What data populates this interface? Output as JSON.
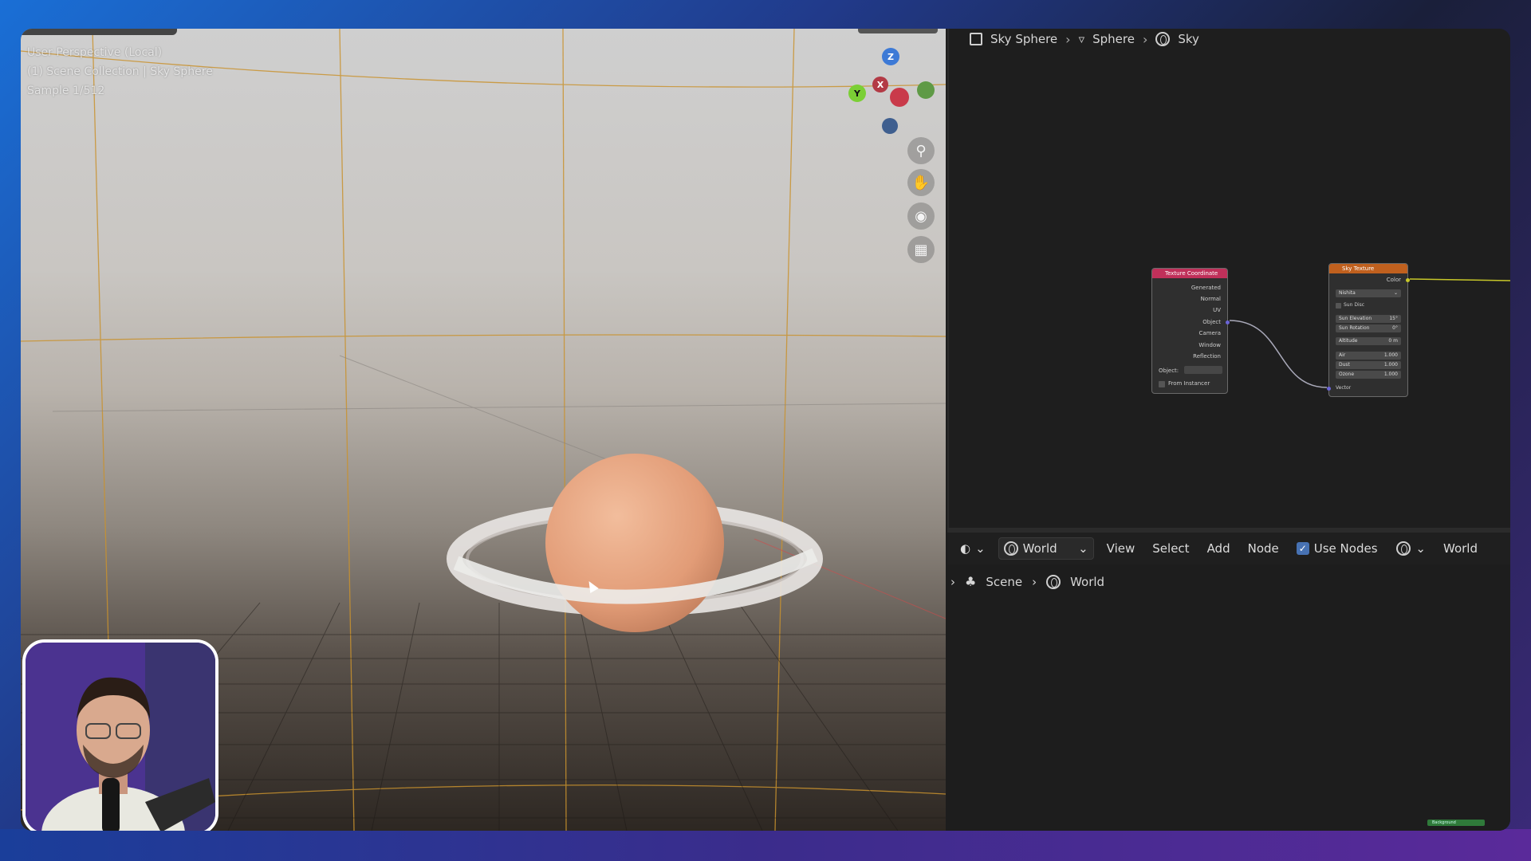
{
  "viewport": {
    "info_lines": [
      "User Perspective (Local)",
      "(1) Scene Collection | Sky Sphere",
      "Sample 1/512"
    ],
    "gizmo_axes": {
      "z": "Z",
      "y": "Y",
      "x": "X"
    },
    "nav_icons": [
      "zoom-icon",
      "pan-hand-icon",
      "camera-icon",
      "grid-icon"
    ]
  },
  "node_editor": {
    "breadcrumb": [
      "Sky Sphere",
      "Sphere",
      "Sky"
    ],
    "texture_coordinate_node": {
      "title": "Texture Coordinate",
      "outputs": [
        "Generated",
        "Normal",
        "UV",
        "Object",
        "Camera",
        "Window",
        "Reflection"
      ],
      "object_label": "Object:",
      "from_instancer": "From Instancer"
    },
    "sky_texture_node": {
      "title": "Sky Texture",
      "output": "Color",
      "sky_type": "Nishita",
      "sun_disc": "Sun Disc",
      "fields": [
        {
          "label": "Sun Elevation",
          "value": "15°"
        },
        {
          "label": "Sun Rotation",
          "value": "0°"
        },
        {
          "label": "Altitude",
          "value": "0 m"
        },
        {
          "label": "Air",
          "value": "1.000"
        },
        {
          "label": "Dust",
          "value": "1.000"
        },
        {
          "label": "Ozone",
          "value": "1.000"
        }
      ],
      "input": "Vector"
    }
  },
  "header": {
    "world_dropdown": "World",
    "menus": [
      "View",
      "Select",
      "Add",
      "Node"
    ],
    "use_nodes_label": "Use Nodes",
    "use_nodes_checked": true,
    "right_world": "World"
  },
  "properties": {
    "breadcrumb": [
      "Scene",
      "World"
    ]
  },
  "status": {
    "pill": "Background"
  },
  "colors": {
    "accent_blue": "#4772b3",
    "tex_coord_header": "#c0305a",
    "sky_header": "#c0601e",
    "planet": "#e8a983"
  }
}
